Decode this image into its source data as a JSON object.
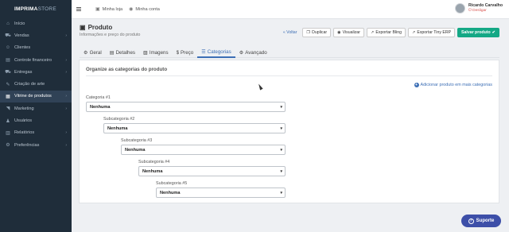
{
  "brand": {
    "bold": "IMPRIMA",
    "light": "STORE"
  },
  "sidebar": {
    "items": [
      {
        "icon": "home-icon",
        "glyph": "⌂",
        "label": "Início"
      },
      {
        "icon": "cart-icon",
        "glyph": "⛟",
        "label": "Vendas",
        "chevron": "›"
      },
      {
        "icon": "users-icon",
        "glyph": "☺",
        "label": "Clientes"
      },
      {
        "icon": "wallet-icon",
        "glyph": "▤",
        "label": "Controle financeiro",
        "chevron": "›"
      },
      {
        "icon": "truck-icon",
        "glyph": "⛟",
        "label": "Entregas",
        "chevron": "›"
      },
      {
        "icon": "pencil-icon",
        "glyph": "✎",
        "label": "Criação de arte"
      },
      {
        "icon": "grid-icon",
        "glyph": "▦",
        "label": "Vitrine de produtos",
        "chevron": "›",
        "active": true
      },
      {
        "icon": "megaphone-icon",
        "glyph": "◥",
        "label": "Marketing",
        "chevron": "›"
      },
      {
        "icon": "user-icon",
        "glyph": "♟",
        "label": "Usuários"
      },
      {
        "icon": "chart-icon",
        "glyph": "▥",
        "label": "Relatórios",
        "chevron": "›"
      },
      {
        "icon": "gears-icon",
        "glyph": "⚙",
        "label": "Preferências",
        "chevron": "›"
      }
    ]
  },
  "topbar": {
    "store_label": "Minha loja",
    "account_label": "Minha conta",
    "user_name": "Ricardo Carvalho",
    "logout_label": "Desligar"
  },
  "header": {
    "title": "Produto",
    "subtitle": "Informações e preço do produto"
  },
  "actions": {
    "back": "« Voltar",
    "duplicate": "Duplicar",
    "view": "Visualizar",
    "export_bling": "Exportar Bling",
    "export_tiny": "Exportar Tiny ERP",
    "save": "Salvar produto"
  },
  "tabs": [
    {
      "icon": "gear-icon",
      "glyph": "⚙",
      "label": "Geral"
    },
    {
      "icon": "document-icon",
      "glyph": "▤",
      "label": "Detalhes"
    },
    {
      "icon": "image-icon",
      "glyph": "▨",
      "label": "Imagens"
    },
    {
      "icon": "dollar-icon",
      "glyph": "$",
      "label": "Preço"
    },
    {
      "icon": "list-icon",
      "glyph": "☰",
      "label": "Categorias",
      "active": true
    },
    {
      "icon": "cogs-icon",
      "glyph": "⚙",
      "label": "Avançado"
    }
  ],
  "categories": {
    "heading": "Organize as categorias do produto",
    "add_link": "Adicionar produto em mais categorias",
    "levels": [
      {
        "label": "Categoria #1",
        "value": "Nenhuma"
      },
      {
        "label": "Subcategoria #2",
        "value": "Nenhuma"
      },
      {
        "label": "Subcategoria #3",
        "value": "Nenhuma"
      },
      {
        "label": "Subcategoria #4",
        "value": "Nenhuma"
      },
      {
        "label": "Subcategoria #5",
        "value": "Nenhuma"
      }
    ]
  },
  "support_label": "Suporte",
  "colors": {
    "sidebar": "#1f2d3a",
    "accent": "#3d6fb5",
    "save": "#14a885",
    "support": "#3d4fa8"
  }
}
